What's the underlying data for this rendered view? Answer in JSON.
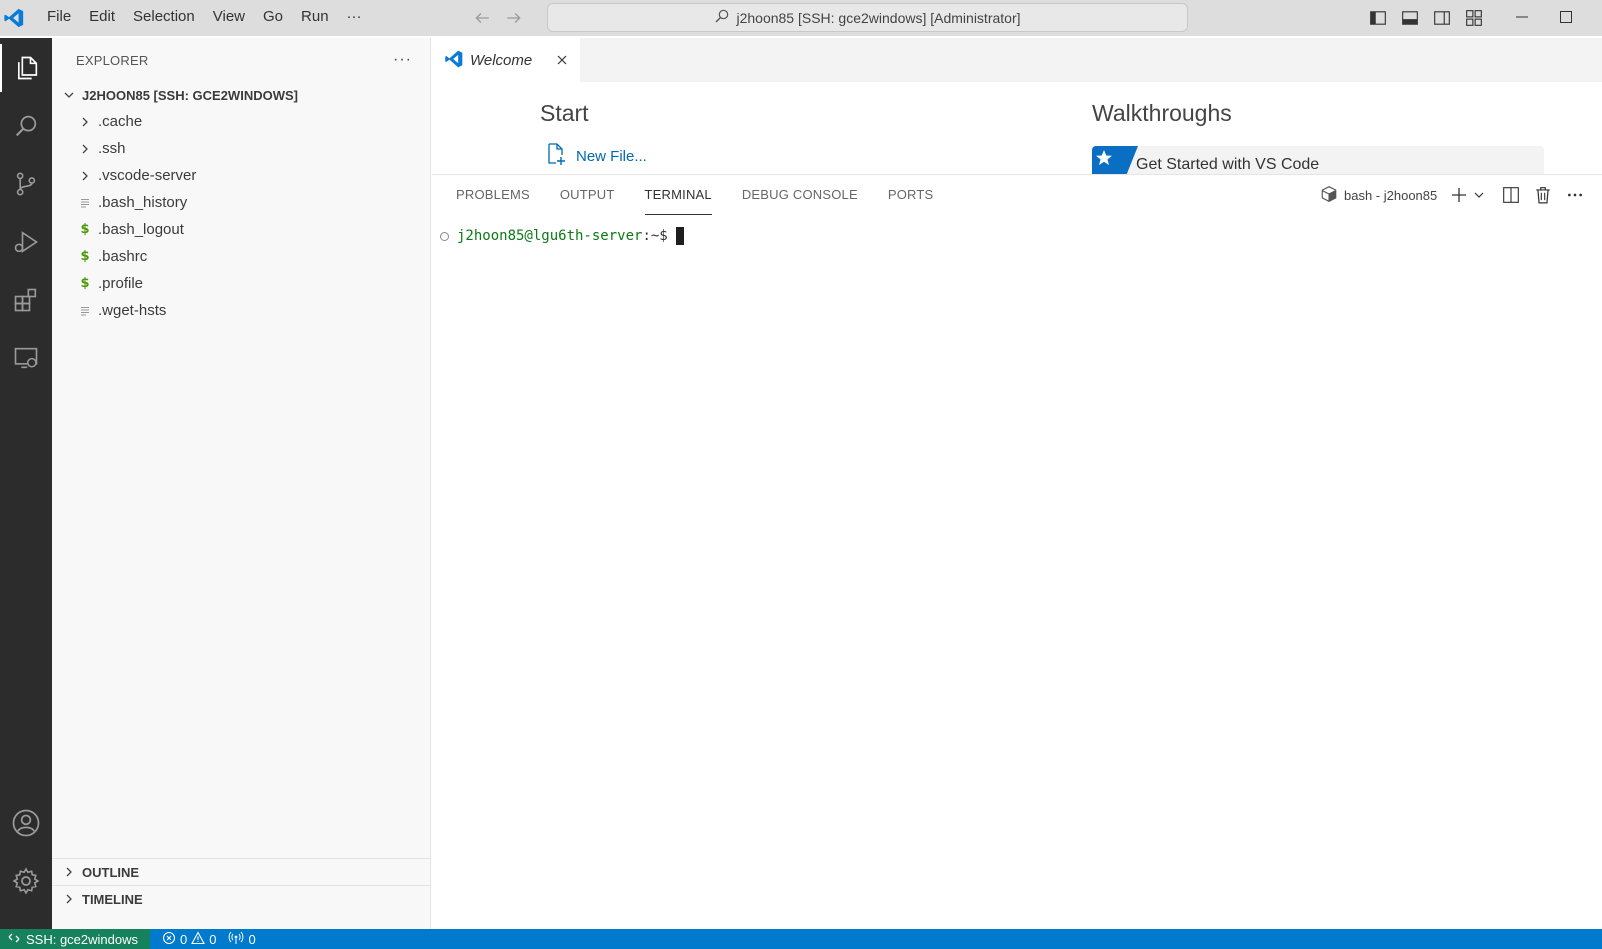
{
  "titlebar": {
    "menu": [
      "File",
      "Edit",
      "Selection",
      "View",
      "Go",
      "Run",
      "···"
    ],
    "command_center": "j2hoon85 [SSH: gce2windows] [Administrator]"
  },
  "sidebar": {
    "title": "EXPLORER",
    "more": "···",
    "root": "J2HOON85 [SSH: GCE2WINDOWS]",
    "items": [
      {
        "label": ".cache",
        "kind": "folder"
      },
      {
        "label": ".ssh",
        "kind": "folder"
      },
      {
        "label": ".vscode-server",
        "kind": "folder"
      },
      {
        "label": ".bash_history",
        "kind": "text"
      },
      {
        "label": ".bash_logout",
        "kind": "shell"
      },
      {
        "label": ".bashrc",
        "kind": "shell"
      },
      {
        "label": ".profile",
        "kind": "shell"
      },
      {
        "label": ".wget-hsts",
        "kind": "text"
      }
    ],
    "outline": "OUTLINE",
    "timeline": "TIMELINE"
  },
  "editor": {
    "tab_label": "Welcome",
    "start_heading": "Start",
    "new_file": "New File...",
    "walkthroughs_heading": "Walkthroughs",
    "walkthrough_card": "Get Started with VS Code"
  },
  "panel": {
    "tabs": [
      "PROBLEMS",
      "OUTPUT",
      "TERMINAL",
      "DEBUG CONSOLE",
      "PORTS"
    ],
    "active_tab": "TERMINAL",
    "terminal_name": "bash - j2hoon85",
    "prompt_user": "j2hoon85@lgu6th-server",
    "prompt_suffix": ":~$"
  },
  "statusbar": {
    "remote": "SSH: gce2windows",
    "errors": "0",
    "warnings": "0",
    "ports": "0"
  },
  "colors": {
    "accent": "#007acc",
    "remote": "#16825d",
    "activitybar": "#2c2c2c",
    "prompt_green": "#0b7a15"
  }
}
